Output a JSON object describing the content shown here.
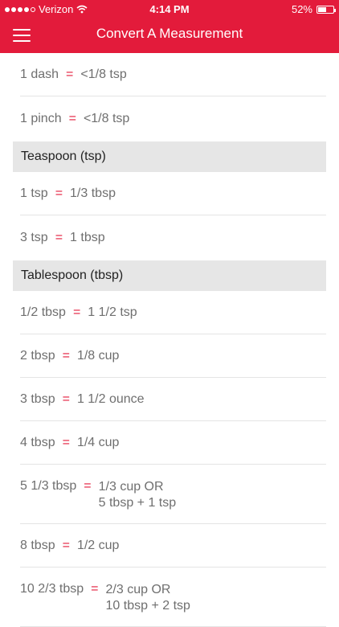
{
  "status_bar": {
    "carrier": "Verizon",
    "time": "4:14 PM",
    "battery": "52%"
  },
  "nav": {
    "title": "Convert A Measurement"
  },
  "rows_top": [
    {
      "lhs": "1 dash",
      "eq": "=",
      "rhs": "<1/8 tsp"
    },
    {
      "lhs": "1 pinch",
      "eq": "=",
      "rhs": "<1/8 tsp"
    }
  ],
  "sections": [
    {
      "title": "Teaspoon (tsp)"
    },
    {
      "title": "Tablespoon (tbsp)"
    }
  ],
  "teaspoon_rows": [
    {
      "lhs": "1 tsp",
      "eq": "=",
      "rhs": "1/3 tbsp"
    },
    {
      "lhs": "3 tsp",
      "eq": "=",
      "rhs": "1 tbsp"
    }
  ],
  "tablespoon_rows": [
    {
      "lhs": "1/2 tbsp",
      "eq": "=",
      "rhs": "1 1/2 tsp"
    },
    {
      "lhs": "2 tbsp",
      "eq": "=",
      "rhs": "1/8 cup"
    },
    {
      "lhs": "3 tbsp",
      "eq": "=",
      "rhs": "1 1/2 ounce"
    },
    {
      "lhs": "4 tbsp",
      "eq": "=",
      "rhs": "1/4 cup"
    },
    {
      "lhs": "5 1/3 tbsp",
      "eq": "=",
      "rhs": "1/3 cup OR",
      "rhs2": "5 tbsp + 1 tsp"
    },
    {
      "lhs": "8 tbsp",
      "eq": "=",
      "rhs": "1/2 cup"
    },
    {
      "lhs": "10 2/3 tbsp",
      "eq": "=",
      "rhs": "2/3 cup OR",
      "rhs2": "10 tbsp + 2 tsp"
    }
  ],
  "colors": {
    "accent": "#e31b3b",
    "section_bg": "#e6e6e6",
    "text": "#6f6f6f"
  }
}
